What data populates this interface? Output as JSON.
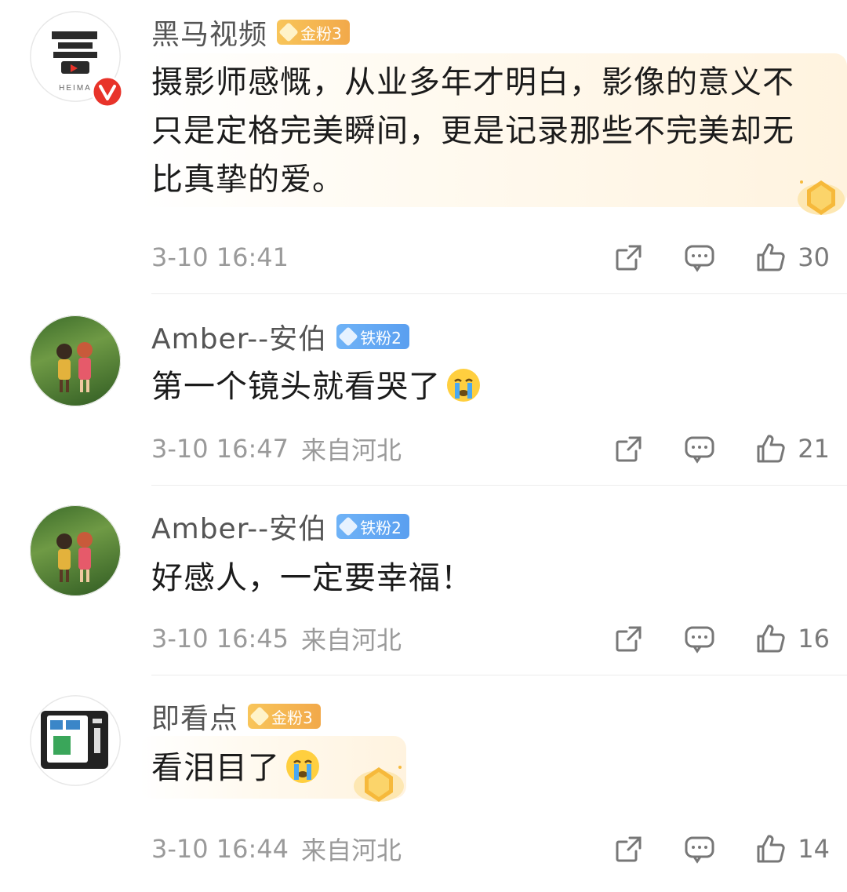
{
  "comments": [
    {
      "username": "黑马视频",
      "badge": "金粉3",
      "badge_type": "gold",
      "text": "摄影师感慨，从业多年才明白，影像的意义不只是定格完美瞬间，更是记录那些不完美却无比真挚的爱。",
      "time": "3-10 16:41",
      "location": "",
      "likes": "30",
      "verified": true
    },
    {
      "username": "Amber--安伯",
      "badge": "铁粉2",
      "badge_type": "iron",
      "text": "第一个镜头就看哭了",
      "emoji": "crying-face",
      "time": "3-10 16:47",
      "location": "来自河北",
      "likes": "21"
    },
    {
      "username": "Amber--安伯",
      "badge": "铁粉2",
      "badge_type": "iron",
      "text": "好感人，一定要幸福！",
      "time": "3-10 16:45",
      "location": "来自河北",
      "likes": "16"
    },
    {
      "username": "即看点",
      "badge": "金粉3",
      "badge_type": "gold",
      "text": "看泪目了",
      "emoji": "crying-face",
      "time": "3-10 16:44",
      "location": "来自河北",
      "likes": "14"
    }
  ],
  "avatar_logo_text": "HEIMA",
  "colors": {
    "gold_badge": "#f2a94a",
    "iron_badge": "#5a9ff0",
    "verified": "#e8332a",
    "muted": "#9a9a9a"
  }
}
